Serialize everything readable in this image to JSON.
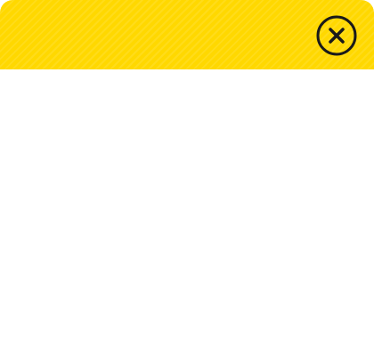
{
  "dialog": {
    "header": {
      "background_color": "#ffd800",
      "pattern": "diagonal-stripes",
      "close_button": {
        "icon": "close-circle-icon",
        "icon_color": "#1a1a1a"
      }
    },
    "body": {
      "background_color": "#ffffff"
    }
  }
}
